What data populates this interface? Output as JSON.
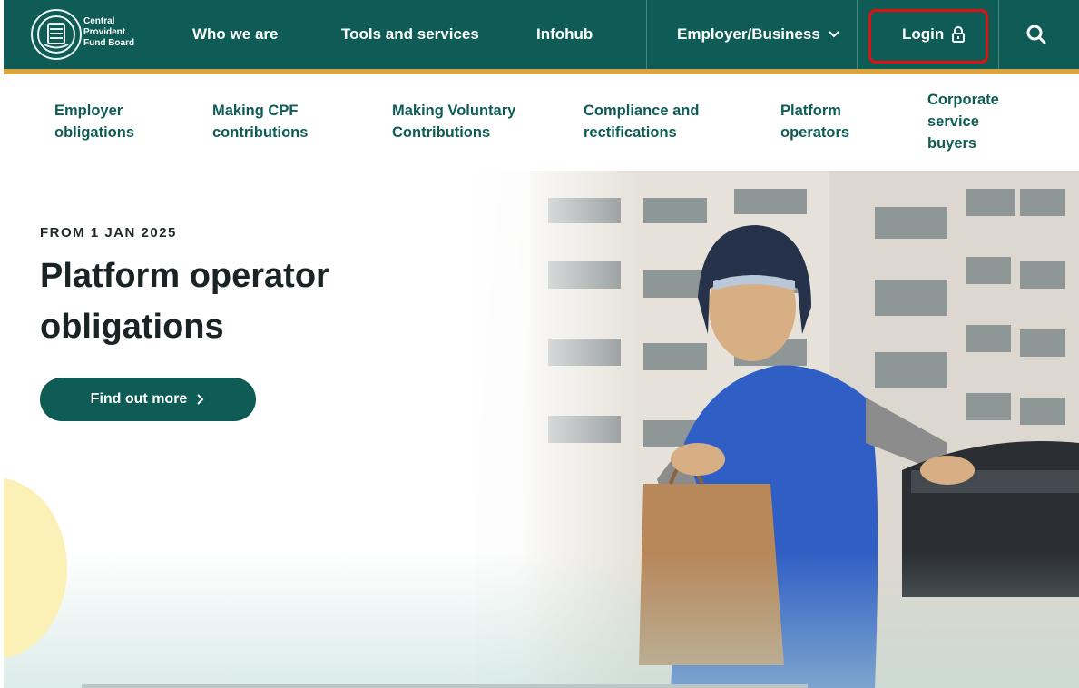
{
  "brand": {
    "logo_text": "Central\nProvident\nFund Board"
  },
  "nav": {
    "items": [
      {
        "label": "Who we are"
      },
      {
        "label": "Tools and services"
      },
      {
        "label": "Infohub"
      },
      {
        "label": "Employer/Business"
      }
    ],
    "login_label": "Login",
    "icons": {
      "login": "lock-icon",
      "search": "search-icon",
      "dropdown": "chevron-down-icon"
    }
  },
  "subnav": {
    "items": [
      {
        "label": "Employer\nobligations"
      },
      {
        "label": "Making CPF\ncontributions"
      },
      {
        "label": "Making Voluntary\nContributions"
      },
      {
        "label": "Compliance and\nrectifications"
      },
      {
        "label": "Platform\noperators"
      },
      {
        "label": "Corporate\nservice\nbuyers"
      }
    ]
  },
  "hero": {
    "eyebrow": "FROM 1 JAN 2025",
    "title": "Platform operator obligations",
    "cta_label": "Find out more",
    "cta_icon": "chevron-right-icon",
    "image": "delivery-rider-photo"
  },
  "colors": {
    "brand_green": "#0e5c55",
    "accent_gold": "#d9a441",
    "highlight_red": "#e11010",
    "yellow_circle": "#fbf0b5"
  }
}
